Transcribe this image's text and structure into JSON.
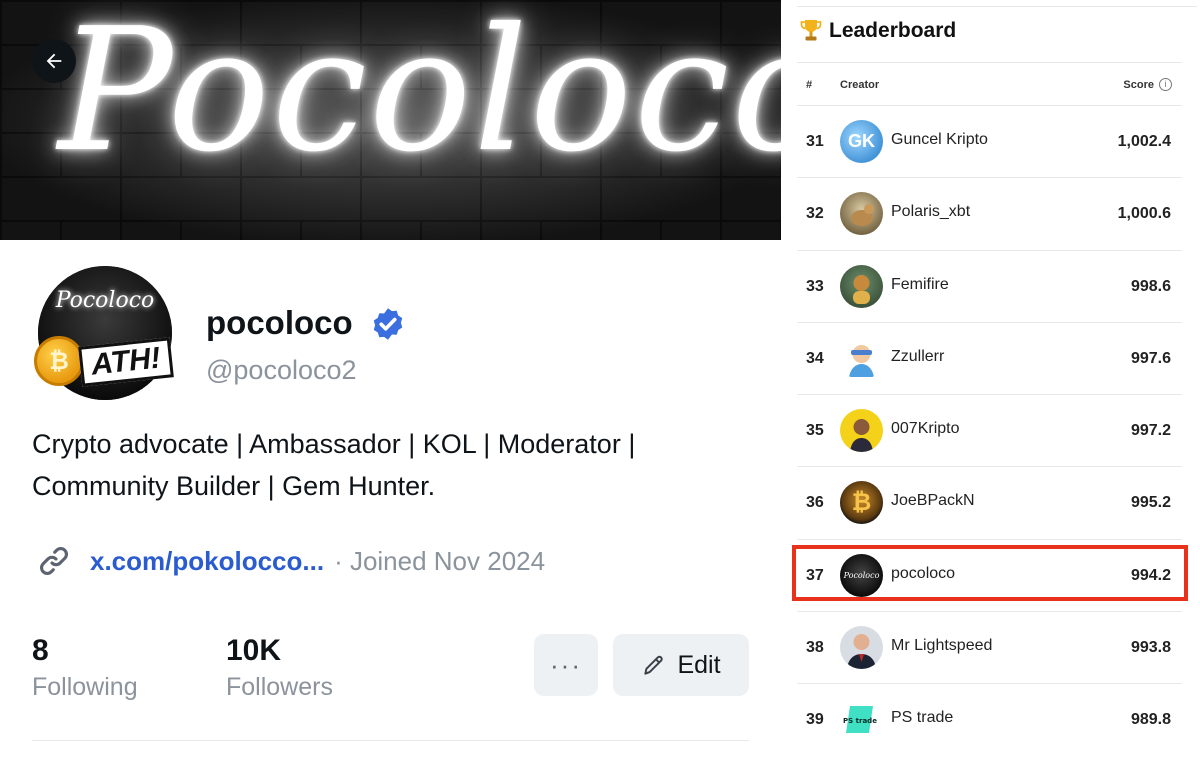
{
  "banner": {
    "text": "Pocoloco"
  },
  "navigation": {
    "back_icon": "arrow-left-icon"
  },
  "profile": {
    "avatar_text": "Pocoloco",
    "avatar_badge": "ATH!",
    "display_name": "pocoloco",
    "handle": "@pocoloco2",
    "verified": true,
    "bio_line1": "Crypto advocate | Ambassador | KOL | Moderator |",
    "bio_line2": "Community Builder | Gem Hunter.",
    "link": "x.com/pokolocco...",
    "joined": "· Joined Nov 2024",
    "following_count": "8",
    "following_label": "Following",
    "followers_count": "10K",
    "followers_label": "Followers",
    "more_label": "···",
    "edit_label": "Edit"
  },
  "leaderboard": {
    "title": "Leaderboard",
    "col_rank": "#",
    "col_creator": "Creator",
    "col_score": "Score",
    "rows": [
      {
        "rank": "31",
        "name": "Guncel Kripto",
        "score": "1,002.4",
        "avatar_label": "GK"
      },
      {
        "rank": "32",
        "name": "Polaris_xbt",
        "score": "1,000.6",
        "avatar_label": ""
      },
      {
        "rank": "33",
        "name": "Femifire",
        "score": "998.6",
        "avatar_label": ""
      },
      {
        "rank": "34",
        "name": "Zzullerr",
        "score": "997.6",
        "avatar_label": ""
      },
      {
        "rank": "35",
        "name": "007Kripto",
        "score": "997.2",
        "avatar_label": ""
      },
      {
        "rank": "36",
        "name": "JoeBPackN",
        "score": "995.2",
        "avatar_label": "₿"
      },
      {
        "rank": "37",
        "name": "pocoloco",
        "score": "994.2",
        "avatar_label": "Pocoloco"
      },
      {
        "rank": "38",
        "name": "Mr Lightspeed",
        "score": "993.8",
        "avatar_label": ""
      },
      {
        "rank": "39",
        "name": "PS trade",
        "score": "989.8",
        "avatar_label": "PS trade"
      }
    ],
    "highlighted_rank": "37"
  },
  "colors": {
    "link": "#2b5ccf",
    "verified": "#3b6fe0",
    "highlight": "#e8321c",
    "muted_text": "#8b939c"
  }
}
